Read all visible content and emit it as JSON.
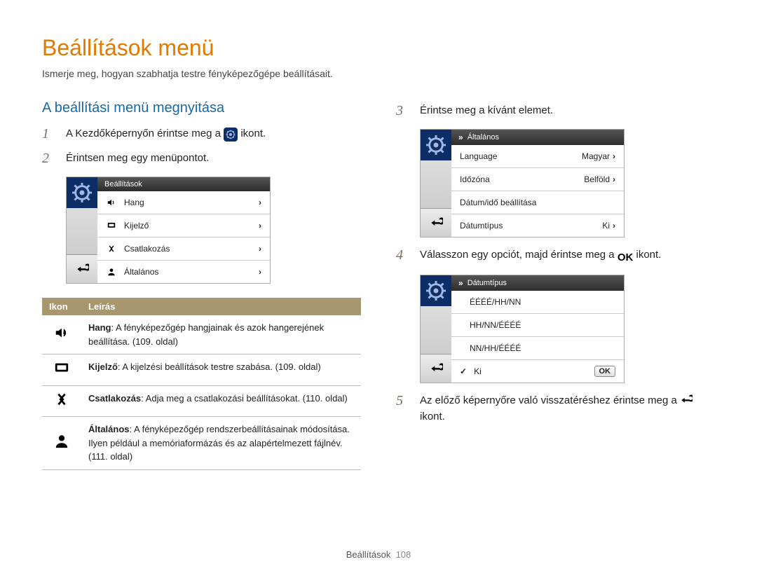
{
  "title": "Beállítások menü",
  "subtitle": "Ismerje meg, hogyan szabhatja testre fényképezőgépe beállításait.",
  "section_heading": "A beállítási menü megnyitása",
  "left": {
    "step1_a": "A Kezdőképernyőn érintse meg a",
    "step1_b": "ikont.",
    "step2": "Érintsen meg egy menüpontot."
  },
  "mock1": {
    "header": "Beállítások",
    "items": [
      {
        "label": "Hang"
      },
      {
        "label": "Kijelző"
      },
      {
        "label": "Csatlakozás"
      },
      {
        "label": "Általános"
      }
    ]
  },
  "dsc": {
    "th_icon": "Ikon",
    "th_desc": "Leírás",
    "rows": [
      {
        "b": "Hang",
        "t": ": A fényképezőgép hangjainak és azok hangerejének beállítása. (109. oldal)"
      },
      {
        "b": "Kijelző",
        "t": ": A kijelzési beállítások testre szabása. (109. oldal)"
      },
      {
        "b": "Csatlakozás",
        "t": ": Adja meg a csatlakozási beállításokat. (110. oldal)"
      },
      {
        "b": "Általános",
        "t": ": A fényképezőgép rendszerbeállításainak módosítása. Ilyen például a memóriaformázás és az alapértelmezett fájlnév. (111. oldal)"
      }
    ]
  },
  "right": {
    "step3": "Érintse meg a kívánt elemet.",
    "step4_a": "Válasszon egy opciót, majd érintse meg a",
    "step4_b": "ikont.",
    "step5_a": "Az előző képernyőre való visszatéréshez érintse meg a",
    "step5_b": "ikont."
  },
  "mock2": {
    "header": "Általános",
    "rows": [
      {
        "label": "Language",
        "value": "Magyar"
      },
      {
        "label": "Időzóna",
        "value": "Belföld"
      },
      {
        "label": "Dátum/idő beállítása",
        "value": ""
      },
      {
        "label": "Dátumtípus",
        "value": "Ki"
      }
    ]
  },
  "mock3": {
    "header": "Dátumtípus",
    "rows": [
      {
        "label": "ÉÉÉÉ/HH/NN"
      },
      {
        "label": "HH/NN/ÉÉÉÉ"
      },
      {
        "label": "NN/HH/ÉÉÉÉ"
      },
      {
        "label": "Ki",
        "checked": true
      }
    ],
    "ok": "OK"
  },
  "ok_text": "OK",
  "footer_section": "Beállítások",
  "footer_page": "108"
}
